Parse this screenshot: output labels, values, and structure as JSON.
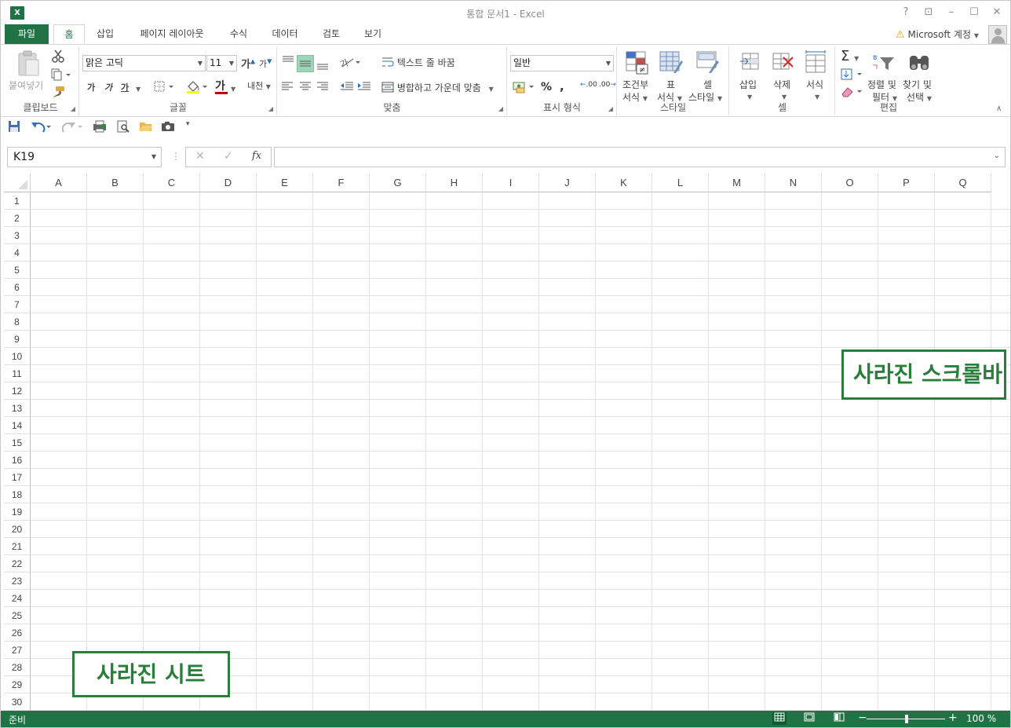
{
  "window": {
    "title": "통합 문서1 - Excel",
    "app_icon": "X",
    "help": "?",
    "ribbon_display": "⊡",
    "minimize": "–",
    "maximize": "☐",
    "close": "✕"
  },
  "tabs": {
    "file": "파일",
    "items": [
      "홈",
      "삽입",
      "페이지 레이아웃",
      "수식",
      "데이터",
      "검토",
      "보기"
    ],
    "active": "홈"
  },
  "account": {
    "label": "Microsoft 계정",
    "warn_icon": "⚠"
  },
  "ribbon": {
    "clipboard": {
      "label": "클립보드",
      "paste": "붙여넣기"
    },
    "font": {
      "label": "글꼴",
      "font_name": "맑은 고딕",
      "font_size": "11",
      "grow": "가",
      "shrink": "가",
      "bold": "가",
      "italic": "가",
      "underline": "가",
      "font_color_glyph": "가",
      "phonetic": "내천"
    },
    "alignment": {
      "label": "맞춤",
      "wrap_text": "텍스트 줄 바꿈",
      "merge_center": "병합하고 가운데 맞춤"
    },
    "number": {
      "label": "표시 형식",
      "format": "일반",
      "percent": "%",
      "comma": ",",
      "inc_decimal": ".00",
      "dec_decimal": ".00"
    },
    "styles": {
      "label": "스타일",
      "conditional_1": "조건부",
      "conditional_2": "서식",
      "table_1": "표",
      "table_2": "서식",
      "cell_1": "셀",
      "cell_2": "스타일"
    },
    "cells": {
      "label": "셀",
      "insert": "삽입",
      "delete": "삭제",
      "format": "서식"
    },
    "editing": {
      "label": "편집",
      "sort_1": "정렬 및",
      "sort_2": "필터",
      "find_1": "찾기 및",
      "find_2": "선택"
    }
  },
  "formula_bar": {
    "name_box": "K19",
    "cancel": "✕",
    "enter": "✓",
    "fx": "fx",
    "value": ""
  },
  "grid": {
    "columns": [
      "A",
      "B",
      "C",
      "D",
      "E",
      "F",
      "G",
      "H",
      "I",
      "J",
      "K",
      "L",
      "M",
      "N",
      "O",
      "P",
      "Q"
    ],
    "rows": [
      "1",
      "2",
      "3",
      "4",
      "5",
      "6",
      "7",
      "8",
      "9",
      "10",
      "11",
      "12",
      "13",
      "14",
      "15",
      "16",
      "17",
      "18",
      "19",
      "20",
      "21",
      "22",
      "23",
      "24",
      "25",
      "26",
      "27",
      "28",
      "29",
      "30"
    ]
  },
  "annotations": {
    "scrollbar": "사라진 스크롤바",
    "sheet": "사라진 시트"
  },
  "status": {
    "ready": "준비",
    "zoom": "100 %",
    "minus": "−",
    "plus": "+"
  },
  "colors": {
    "excel_green": "#217346",
    "annotation_green": "#2a7d3a"
  }
}
